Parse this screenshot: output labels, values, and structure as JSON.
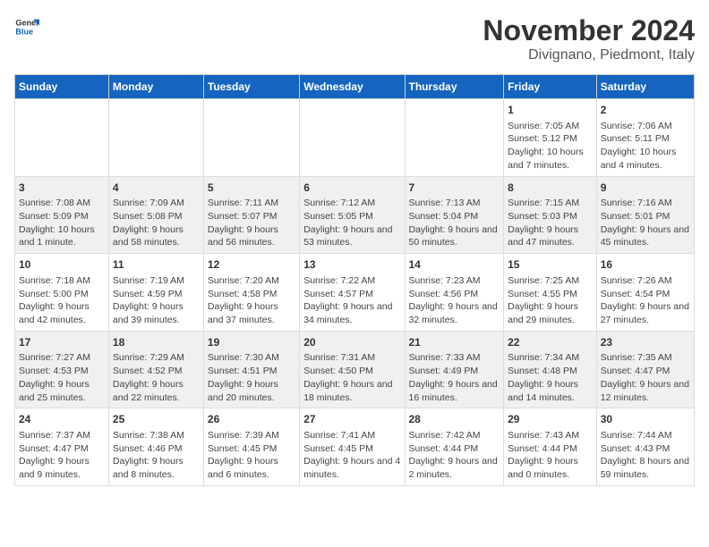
{
  "logo": {
    "general": "General",
    "blue": "Blue"
  },
  "title": "November 2024",
  "subtitle": "Divignano, Piedmont, Italy",
  "days_of_week": [
    "Sunday",
    "Monday",
    "Tuesday",
    "Wednesday",
    "Thursday",
    "Friday",
    "Saturday"
  ],
  "weeks": [
    {
      "days": [
        {
          "number": "",
          "info": ""
        },
        {
          "number": "",
          "info": ""
        },
        {
          "number": "",
          "info": ""
        },
        {
          "number": "",
          "info": ""
        },
        {
          "number": "",
          "info": ""
        },
        {
          "number": "1",
          "info": "Sunrise: 7:05 AM\nSunset: 5:12 PM\nDaylight: 10 hours and 7 minutes."
        },
        {
          "number": "2",
          "info": "Sunrise: 7:06 AM\nSunset: 5:11 PM\nDaylight: 10 hours and 4 minutes."
        }
      ]
    },
    {
      "days": [
        {
          "number": "3",
          "info": "Sunrise: 7:08 AM\nSunset: 5:09 PM\nDaylight: 10 hours and 1 minute."
        },
        {
          "number": "4",
          "info": "Sunrise: 7:09 AM\nSunset: 5:08 PM\nDaylight: 9 hours and 58 minutes."
        },
        {
          "number": "5",
          "info": "Sunrise: 7:11 AM\nSunset: 5:07 PM\nDaylight: 9 hours and 56 minutes."
        },
        {
          "number": "6",
          "info": "Sunrise: 7:12 AM\nSunset: 5:05 PM\nDaylight: 9 hours and 53 minutes."
        },
        {
          "number": "7",
          "info": "Sunrise: 7:13 AM\nSunset: 5:04 PM\nDaylight: 9 hours and 50 minutes."
        },
        {
          "number": "8",
          "info": "Sunrise: 7:15 AM\nSunset: 5:03 PM\nDaylight: 9 hours and 47 minutes."
        },
        {
          "number": "9",
          "info": "Sunrise: 7:16 AM\nSunset: 5:01 PM\nDaylight: 9 hours and 45 minutes."
        }
      ]
    },
    {
      "days": [
        {
          "number": "10",
          "info": "Sunrise: 7:18 AM\nSunset: 5:00 PM\nDaylight: 9 hours and 42 minutes."
        },
        {
          "number": "11",
          "info": "Sunrise: 7:19 AM\nSunset: 4:59 PM\nDaylight: 9 hours and 39 minutes."
        },
        {
          "number": "12",
          "info": "Sunrise: 7:20 AM\nSunset: 4:58 PM\nDaylight: 9 hours and 37 minutes."
        },
        {
          "number": "13",
          "info": "Sunrise: 7:22 AM\nSunset: 4:57 PM\nDaylight: 9 hours and 34 minutes."
        },
        {
          "number": "14",
          "info": "Sunrise: 7:23 AM\nSunset: 4:56 PM\nDaylight: 9 hours and 32 minutes."
        },
        {
          "number": "15",
          "info": "Sunrise: 7:25 AM\nSunset: 4:55 PM\nDaylight: 9 hours and 29 minutes."
        },
        {
          "number": "16",
          "info": "Sunrise: 7:26 AM\nSunset: 4:54 PM\nDaylight: 9 hours and 27 minutes."
        }
      ]
    },
    {
      "days": [
        {
          "number": "17",
          "info": "Sunrise: 7:27 AM\nSunset: 4:53 PM\nDaylight: 9 hours and 25 minutes."
        },
        {
          "number": "18",
          "info": "Sunrise: 7:29 AM\nSunset: 4:52 PM\nDaylight: 9 hours and 22 minutes."
        },
        {
          "number": "19",
          "info": "Sunrise: 7:30 AM\nSunset: 4:51 PM\nDaylight: 9 hours and 20 minutes."
        },
        {
          "number": "20",
          "info": "Sunrise: 7:31 AM\nSunset: 4:50 PM\nDaylight: 9 hours and 18 minutes."
        },
        {
          "number": "21",
          "info": "Sunrise: 7:33 AM\nSunset: 4:49 PM\nDaylight: 9 hours and 16 minutes."
        },
        {
          "number": "22",
          "info": "Sunrise: 7:34 AM\nSunset: 4:48 PM\nDaylight: 9 hours and 14 minutes."
        },
        {
          "number": "23",
          "info": "Sunrise: 7:35 AM\nSunset: 4:47 PM\nDaylight: 9 hours and 12 minutes."
        }
      ]
    },
    {
      "days": [
        {
          "number": "24",
          "info": "Sunrise: 7:37 AM\nSunset: 4:47 PM\nDaylight: 9 hours and 9 minutes."
        },
        {
          "number": "25",
          "info": "Sunrise: 7:38 AM\nSunset: 4:46 PM\nDaylight: 9 hours and 8 minutes."
        },
        {
          "number": "26",
          "info": "Sunrise: 7:39 AM\nSunset: 4:45 PM\nDaylight: 9 hours and 6 minutes."
        },
        {
          "number": "27",
          "info": "Sunrise: 7:41 AM\nSunset: 4:45 PM\nDaylight: 9 hours and 4 minutes."
        },
        {
          "number": "28",
          "info": "Sunrise: 7:42 AM\nSunset: 4:44 PM\nDaylight: 9 hours and 2 minutes."
        },
        {
          "number": "29",
          "info": "Sunrise: 7:43 AM\nSunset: 4:44 PM\nDaylight: 9 hours and 0 minutes."
        },
        {
          "number": "30",
          "info": "Sunrise: 7:44 AM\nSunset: 4:43 PM\nDaylight: 8 hours and 59 minutes."
        }
      ]
    }
  ]
}
